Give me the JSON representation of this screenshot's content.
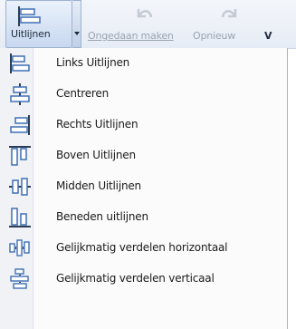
{
  "toolbar": {
    "align_label": "Uitlijnen",
    "undo_label": "Ongedaan maken",
    "redo_label": "Opnieuw",
    "next_label": "V"
  },
  "menu": {
    "items": [
      {
        "label": "Links Uitlijnen",
        "icon": "align-left-icon"
      },
      {
        "label": "Centreren",
        "icon": "align-center-icon"
      },
      {
        "label": "Rechts Uitlijnen",
        "icon": "align-right-icon"
      },
      {
        "label": "Boven Uitlijnen",
        "icon": "align-top-icon"
      },
      {
        "label": "Midden Uitlijnen",
        "icon": "align-middle-icon"
      },
      {
        "label": "Beneden uitlijnen",
        "icon": "align-bottom-icon"
      },
      {
        "label": "Gelijkmatig verdelen horizontaal",
        "icon": "distribute-horizontal-icon"
      },
      {
        "label": "Gelijkmatig verdelen verticaal",
        "icon": "distribute-vertical-icon"
      }
    ]
  },
  "colors": {
    "icon_blue": "#3f6fb5",
    "icon_dark": "#2c3e57",
    "disabled_text": "#9aa4b1"
  }
}
